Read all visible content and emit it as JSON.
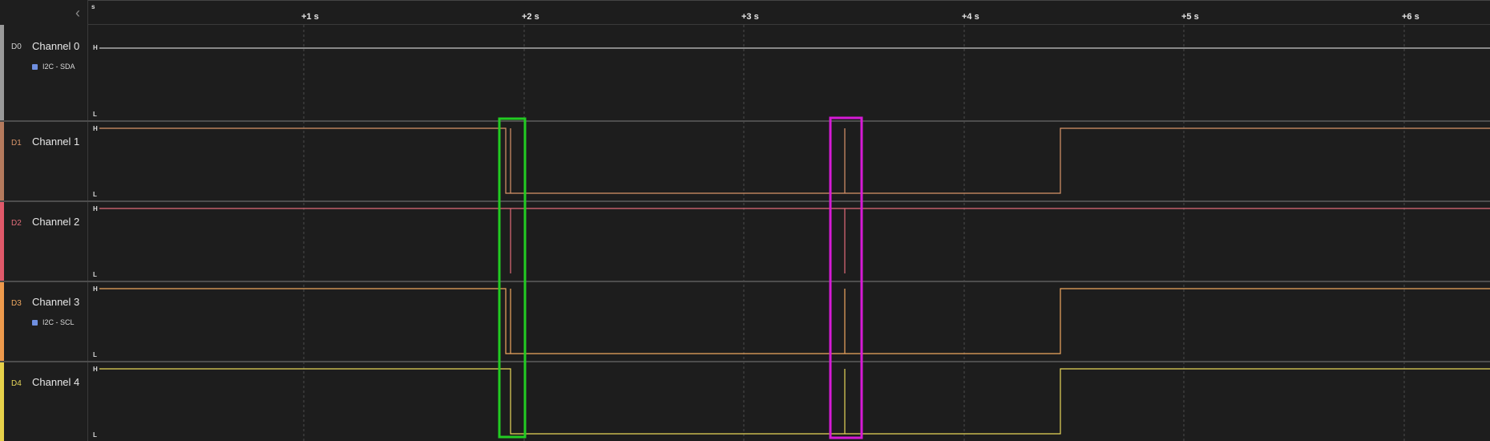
{
  "ruler": {
    "unit": "s",
    "ticks": [
      "+1 s",
      "+2 s",
      "+3 s",
      "+4 s",
      "+5 s",
      "+6 s"
    ]
  },
  "level_labels": {
    "high": "H",
    "low": "L"
  },
  "channels": [
    {
      "id": "D0",
      "name": "Channel 0",
      "analyzer": "I2C - SDA",
      "color": "#c8c8c8",
      "strip": "#9a9a9a"
    },
    {
      "id": "D1",
      "name": "Channel 1",
      "analyzer": "",
      "color": "#d9956a",
      "strip": "#b57a5d"
    },
    {
      "id": "D2",
      "name": "Channel 2",
      "analyzer": "",
      "color": "#e26d7a",
      "strip": "#e0596a"
    },
    {
      "id": "D3",
      "name": "Channel 3",
      "analyzer": "I2C - SCL",
      "color": "#f0a860",
      "strip": "#ee9a4c"
    },
    {
      "id": "D4",
      "name": "Channel 4",
      "analyzer": "",
      "color": "#e8d75a",
      "strip": "#e6d14a"
    }
  ],
  "highlights": [
    {
      "name": "green-highlight-box",
      "color": "#22cc22"
    },
    {
      "name": "magenta-highlight-box",
      "color": "#d61ad6"
    }
  ]
}
